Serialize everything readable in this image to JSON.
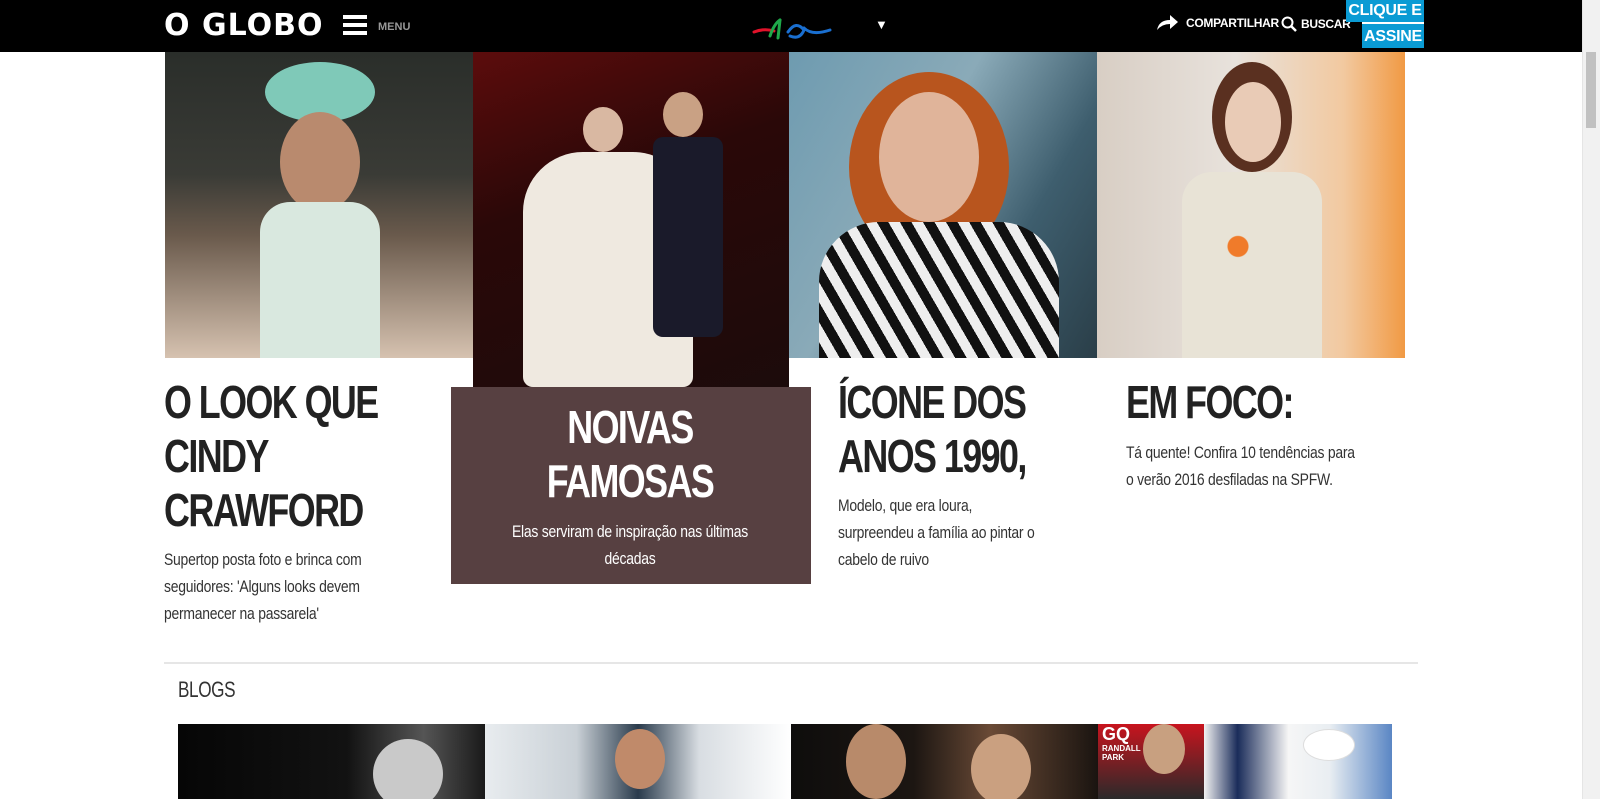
{
  "header": {
    "logo": "O GLOBO",
    "menu_label": "MENU",
    "section_logo": "ela",
    "share_label": "COMPARTILHAR",
    "search_label": "BUSCAR",
    "subscribe_line1": "CLIQUE E",
    "subscribe_line2": "ASSINE"
  },
  "stories": [
    {
      "headline": "O LOOK QUE CINDY CRAWFORD",
      "summary": "Supertop posta foto e brinca com seguidores: 'Alguns looks devem permanecer na passarela'"
    },
    {
      "headline": "NOIVAS FAMOSAS",
      "summary": "Elas serviram de inspiração nas últimas décadas"
    },
    {
      "headline": "ÍCONE DOS ANOS 1990,",
      "summary": "Modelo, que era loura, surpreendeu a família ao pintar o cabelo de ruivo"
    },
    {
      "headline": "EM FOCO:",
      "summary": "Tá quente! Confira 10 tendências para o verão 2016 desfiladas na SPFW."
    }
  ],
  "blogs": {
    "label": "BLOGS",
    "magazine_title": "GQ",
    "magazine_text": "RANDALL PARK"
  },
  "colors": {
    "topbar": "#000000",
    "subscribe": "#0a9bd4",
    "ela_green": "#1fa84a",
    "ela_red": "#e2122a",
    "ela_blue": "#1a6fd0"
  }
}
